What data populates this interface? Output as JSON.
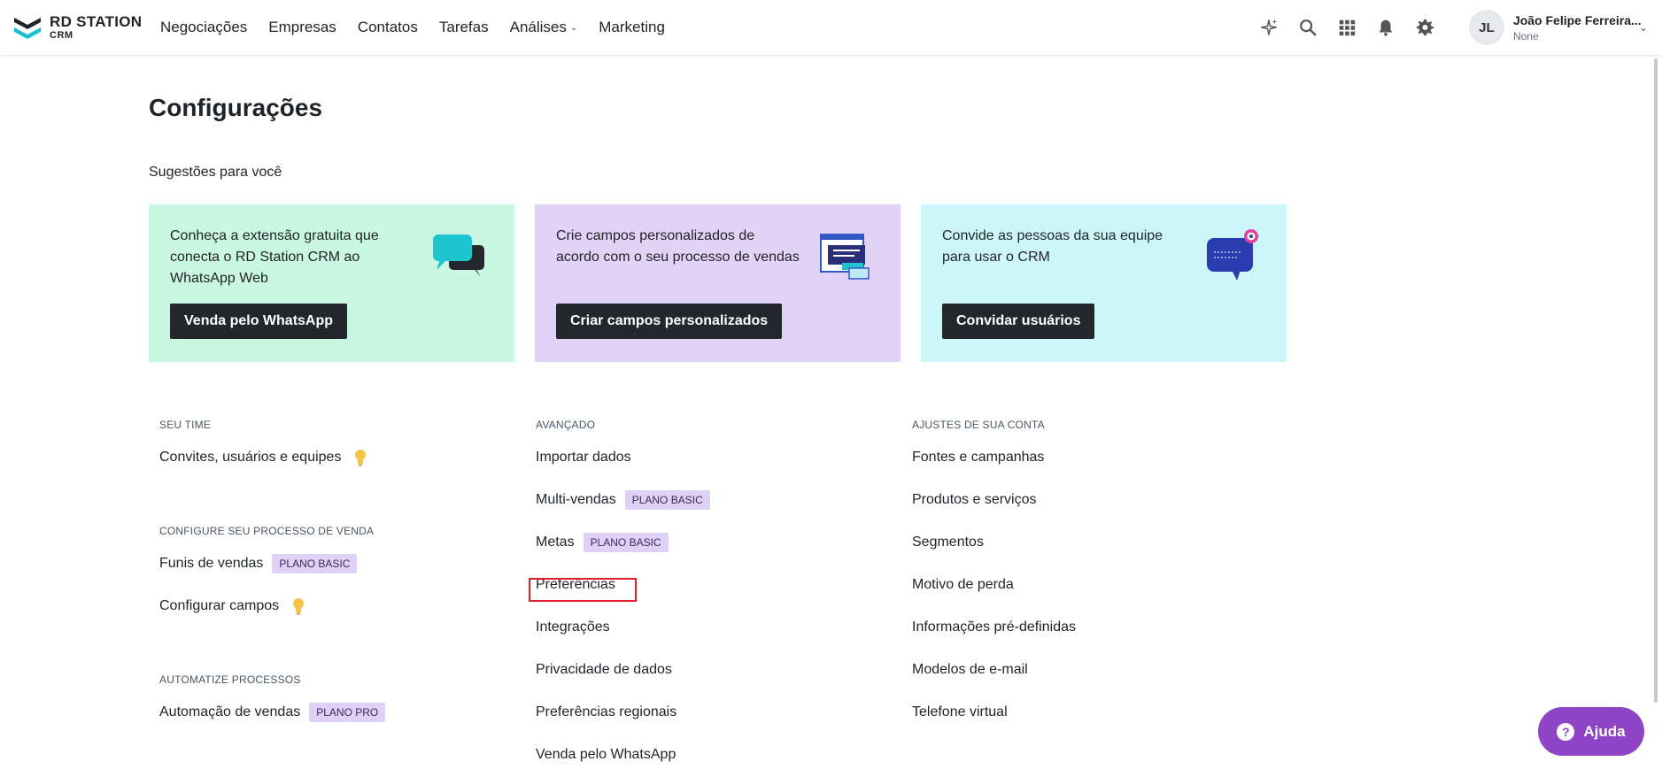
{
  "brand": {
    "name": "RD STATION",
    "product": "CRM"
  },
  "nav": {
    "items": [
      {
        "label": "Negociações"
      },
      {
        "label": "Empresas"
      },
      {
        "label": "Contatos"
      },
      {
        "label": "Tarefas"
      },
      {
        "label": "Análises",
        "has_dropdown": true
      },
      {
        "label": "Marketing"
      }
    ],
    "icons": [
      "sparkle-icon",
      "search-icon",
      "apps-grid-icon",
      "bell-icon",
      "gear-icon"
    ]
  },
  "user": {
    "initials": "JL",
    "name": "João Felipe Ferreira...",
    "sub": "None"
  },
  "page": {
    "title": "Configurações",
    "suggestions_title": "Sugestões para você"
  },
  "cards": [
    {
      "text": "Conheça a extensão gratuita que conecta o RD Station CRM ao WhatsApp Web",
      "button": "Venda pelo WhatsApp",
      "bg": "#c9f7e1"
    },
    {
      "text": "Crie campos personalizados de acordo com o seu processo de vendas",
      "button": "Criar campos personalizados",
      "bg": "#e1d2f6"
    },
    {
      "text": "Convide as pessoas da sua equipe para usar o CRM",
      "button": "Convidar usuários",
      "bg": "#cdf6f8"
    }
  ],
  "sections": {
    "seu_time": {
      "title": "SEU TIME",
      "items": [
        {
          "label": "Convites, usuários e equipes"
        }
      ]
    },
    "processo": {
      "title": "CONFIGURE SEU PROCESSO DE VENDA",
      "items": [
        {
          "label": "Funis de vendas",
          "badge": "PLANO BASIC"
        },
        {
          "label": "Configurar campos"
        }
      ]
    },
    "automatize": {
      "title": "AUTOMATIZE PROCESSOS",
      "items": [
        {
          "label": "Automação de vendas",
          "badge": "PLANO PRO"
        }
      ]
    },
    "avancado": {
      "title": "AVANÇADO",
      "items": [
        {
          "label": "Importar dados"
        },
        {
          "label": "Multi-vendas",
          "badge": "PLANO BASIC"
        },
        {
          "label": "Metas",
          "badge": "PLANO BASIC"
        },
        {
          "label": "Preferências"
        },
        {
          "label": "Integrações"
        },
        {
          "label": "Privacidade de dados"
        },
        {
          "label": "Preferências regionais"
        },
        {
          "label": "Venda pelo WhatsApp"
        }
      ]
    },
    "ajustes": {
      "title": "AJUSTES DE SUA CONTA",
      "items": [
        {
          "label": "Fontes e campanhas"
        },
        {
          "label": "Produtos e serviços"
        },
        {
          "label": "Segmentos"
        },
        {
          "label": "Motivo de perda"
        },
        {
          "label": "Informações pré-definidas"
        },
        {
          "label": "Modelos de e-mail"
        },
        {
          "label": "Telefone virtual"
        }
      ]
    }
  },
  "help": {
    "label": "Ajuda"
  },
  "colors": {
    "accent": "#8e44c5",
    "badge_bg": "#dfd1f5",
    "button_dark": "#23272b",
    "highlight": "#e11d2a"
  }
}
